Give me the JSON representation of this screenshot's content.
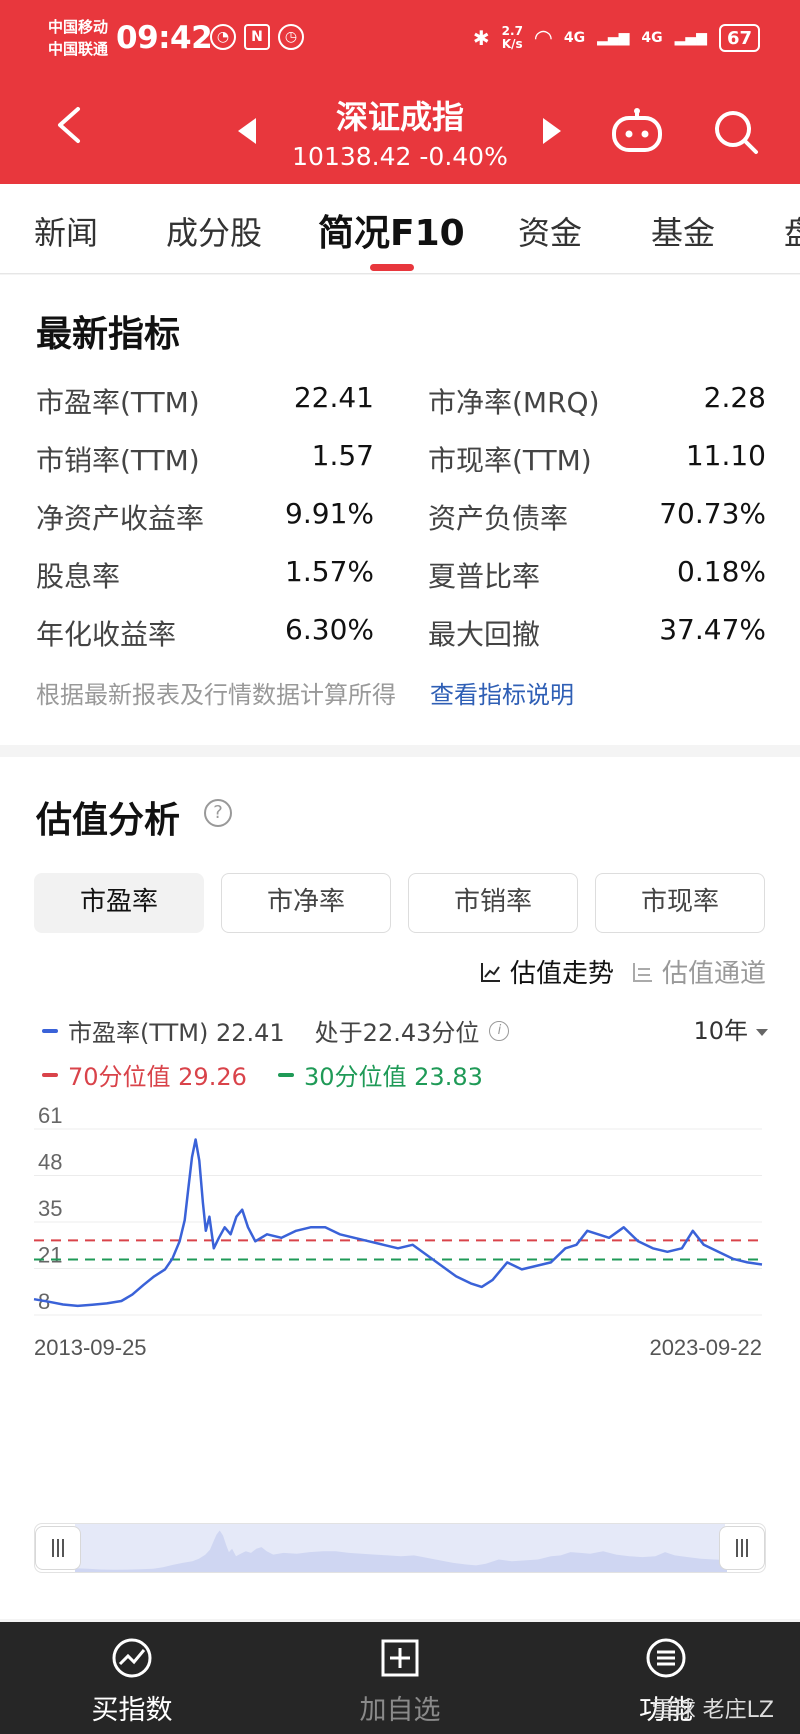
{
  "status_bar": {
    "carrier_1": "中国移动",
    "carrier_2": "中国联通",
    "time": "09:42",
    "speed": "2.7",
    "speed_unit": "K/s",
    "network_1": "4G",
    "network_2": "4G",
    "battery": "67"
  },
  "nav": {
    "title": "深证成指",
    "subtitle": "10138.42  -0.40%"
  },
  "tabs": [
    {
      "label": "新闻"
    },
    {
      "label": "成分股"
    },
    {
      "label": "简况F10",
      "active": true
    },
    {
      "label": "资金"
    },
    {
      "label": "基金"
    },
    {
      "label": "盘"
    }
  ],
  "latest": {
    "title": "最新指标",
    "metrics": [
      {
        "label": "市盈率(TTM)",
        "value": "22.41"
      },
      {
        "label": "市净率(MRQ)",
        "value": "2.28"
      },
      {
        "label": "市销率(TTM)",
        "value": "1.57"
      },
      {
        "label": "市现率(TTM)",
        "value": "11.10"
      },
      {
        "label": "净资产收益率",
        "value": "9.91%"
      },
      {
        "label": "资产负债率",
        "value": "70.73%"
      },
      {
        "label": "股息率",
        "value": "1.57%"
      },
      {
        "label": "夏普比率",
        "value": "0.18%"
      },
      {
        "label": "年化收益率",
        "value": "6.30%"
      },
      {
        "label": "最大回撤",
        "value": "37.47%"
      }
    ],
    "note": "根据最新报表及行情数据计算所得",
    "note_link": "查看指标说明"
  },
  "valuation": {
    "title": "估值分析",
    "help": "?",
    "segments": [
      "市盈率",
      "市净率",
      "市销率",
      "市现率"
    ],
    "active_segment": 0,
    "view_trend": "估值走势",
    "view_channel": "估值通道",
    "legend_main": "市盈率(TTM) 22.41",
    "legend_pct": "处于22.43分位",
    "legend_70": "70分位值 29.26",
    "legend_30": "30分位值 23.83",
    "period": "10年",
    "colors": {
      "main": "#3a62d8",
      "p70": "#d9434a",
      "p30": "#1f9a57"
    }
  },
  "chart_data": {
    "type": "line",
    "y_ticks": [
      "61",
      "48",
      "35",
      "21",
      "8"
    ],
    "ylim": [
      8,
      61
    ],
    "x_labels": [
      "2013-09-25",
      "2023-09-22"
    ],
    "series": [
      {
        "name": "市盈率(TTM)",
        "values": [
          [
            0.0,
            12.5
          ],
          [
            0.02,
            11.8
          ],
          [
            0.04,
            11.0
          ],
          [
            0.06,
            10.6
          ],
          [
            0.08,
            10.9
          ],
          [
            0.1,
            11.3
          ],
          [
            0.12,
            12.0
          ],
          [
            0.135,
            13.8
          ],
          [
            0.15,
            16.5
          ],
          [
            0.165,
            19.0
          ],
          [
            0.18,
            21.0
          ],
          [
            0.19,
            24.0
          ],
          [
            0.2,
            29.0
          ],
          [
            0.207,
            35.0
          ],
          [
            0.212,
            44.0
          ],
          [
            0.217,
            53.0
          ],
          [
            0.222,
            58.0
          ],
          [
            0.227,
            52.0
          ],
          [
            0.232,
            40.0
          ],
          [
            0.236,
            32.0
          ],
          [
            0.241,
            36.0
          ],
          [
            0.247,
            27.0
          ],
          [
            0.254,
            30.0
          ],
          [
            0.262,
            33.0
          ],
          [
            0.27,
            31.0
          ],
          [
            0.278,
            36.0
          ],
          [
            0.286,
            38.0
          ],
          [
            0.294,
            33.0
          ],
          [
            0.304,
            29.0
          ],
          [
            0.32,
            31.0
          ],
          [
            0.34,
            30.0
          ],
          [
            0.36,
            32.0
          ],
          [
            0.38,
            33.0
          ],
          [
            0.4,
            33.0
          ],
          [
            0.42,
            31.0
          ],
          [
            0.44,
            30.0
          ],
          [
            0.46,
            29.0
          ],
          [
            0.48,
            28.0
          ],
          [
            0.5,
            27.0
          ],
          [
            0.52,
            28.0
          ],
          [
            0.54,
            25.0
          ],
          [
            0.56,
            22.0
          ],
          [
            0.58,
            19.0
          ],
          [
            0.6,
            17.0
          ],
          [
            0.615,
            16.0
          ],
          [
            0.63,
            18.0
          ],
          [
            0.65,
            23.0
          ],
          [
            0.67,
            21.0
          ],
          [
            0.69,
            22.0
          ],
          [
            0.71,
            23.0
          ],
          [
            0.73,
            27.0
          ],
          [
            0.745,
            28.0
          ],
          [
            0.76,
            32.0
          ],
          [
            0.775,
            31.0
          ],
          [
            0.79,
            30.0
          ],
          [
            0.81,
            33.0
          ],
          [
            0.83,
            29.0
          ],
          [
            0.85,
            27.0
          ],
          [
            0.87,
            26.0
          ],
          [
            0.89,
            27.0
          ],
          [
            0.905,
            32.0
          ],
          [
            0.92,
            28.0
          ],
          [
            0.94,
            26.0
          ],
          [
            0.96,
            24.0
          ],
          [
            0.98,
            23.0
          ],
          [
            1.0,
            22.4
          ]
        ]
      }
    ],
    "reference_lines": [
      {
        "name": "70分位值",
        "value": 29.26
      },
      {
        "name": "30分位值",
        "value": 23.83
      }
    ],
    "grid": true
  },
  "bottom_bar": {
    "buy": "买指数",
    "add": "加自选",
    "func": "功能",
    "watermark": "雪球  老庄LZ"
  }
}
